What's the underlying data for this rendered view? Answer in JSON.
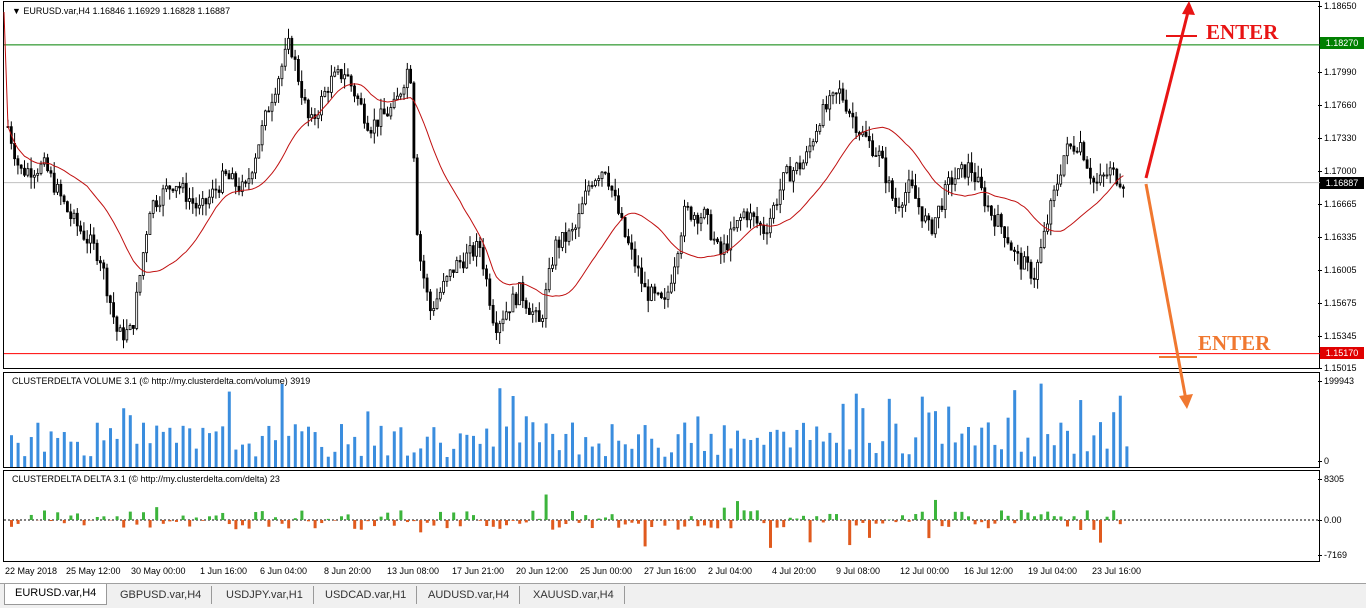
{
  "chart": {
    "symbol_title": "EURUSD.var,H4  1.16846 1.16929 1.16828 1.16887",
    "price_ticks": [
      "1.18650",
      "1.17990",
      "1.17660",
      "1.17330",
      "1.17000",
      "1.16665",
      "1.16335",
      "1.16005",
      "1.15675",
      "1.15345",
      "1.15015"
    ],
    "levels": {
      "upper": "1.18270",
      "current": "1.16887",
      "lower": "1.15170"
    },
    "annotations": {
      "enter_top": "ENTER",
      "enter_bottom": "ENTER"
    },
    "colors": {
      "upper_level": "#008000",
      "lower_level": "#ff0000",
      "arrow_up": "#e81414",
      "arrow_down": "#f07830",
      "ma": "#c01010",
      "volume": "#3a8dde",
      "delta_pos": "#3cb43c",
      "delta_neg": "#e05a1e"
    },
    "date_labels": [
      "22 May 2018",
      "25 May 12:00",
      "30 May 00:00",
      "1 Jun 16:00",
      "6 Jun 04:00",
      "8 Jun 20:00",
      "13 Jun 08:00",
      "17 Jun 21:00",
      "20 Jun 12:00",
      "25 Jun 00:00",
      "27 Jun 16:00",
      "2 Jul 04:00",
      "4 Jul 20:00",
      "9 Jul 08:00",
      "12 Jul 00:00",
      "16 Jul 12:00",
      "19 Jul 04:00",
      "23 Jul 16:00"
    ]
  },
  "volume_indicator": {
    "title": "CLUSTERDELTA VOLUME 3.1 (© http://my.clusterdelta.com/volume) 3919",
    "max_label": "199943",
    "zero_label": "0"
  },
  "delta_indicator": {
    "title": "CLUSTERDELTA DELTA 3.1 (© http://my.clusterdelta.com/delta) 23",
    "max_label": "8305",
    "zero_label": "0.00",
    "min_label": "-7169"
  },
  "tabs": [
    "EURUSD.var,H4",
    "GBPUSD.var,H4",
    "USDJPY.var,H1",
    "USDCAD.var,H1",
    "AUDUSD.var,H4",
    "XAUUSD.var,H4"
  ]
}
